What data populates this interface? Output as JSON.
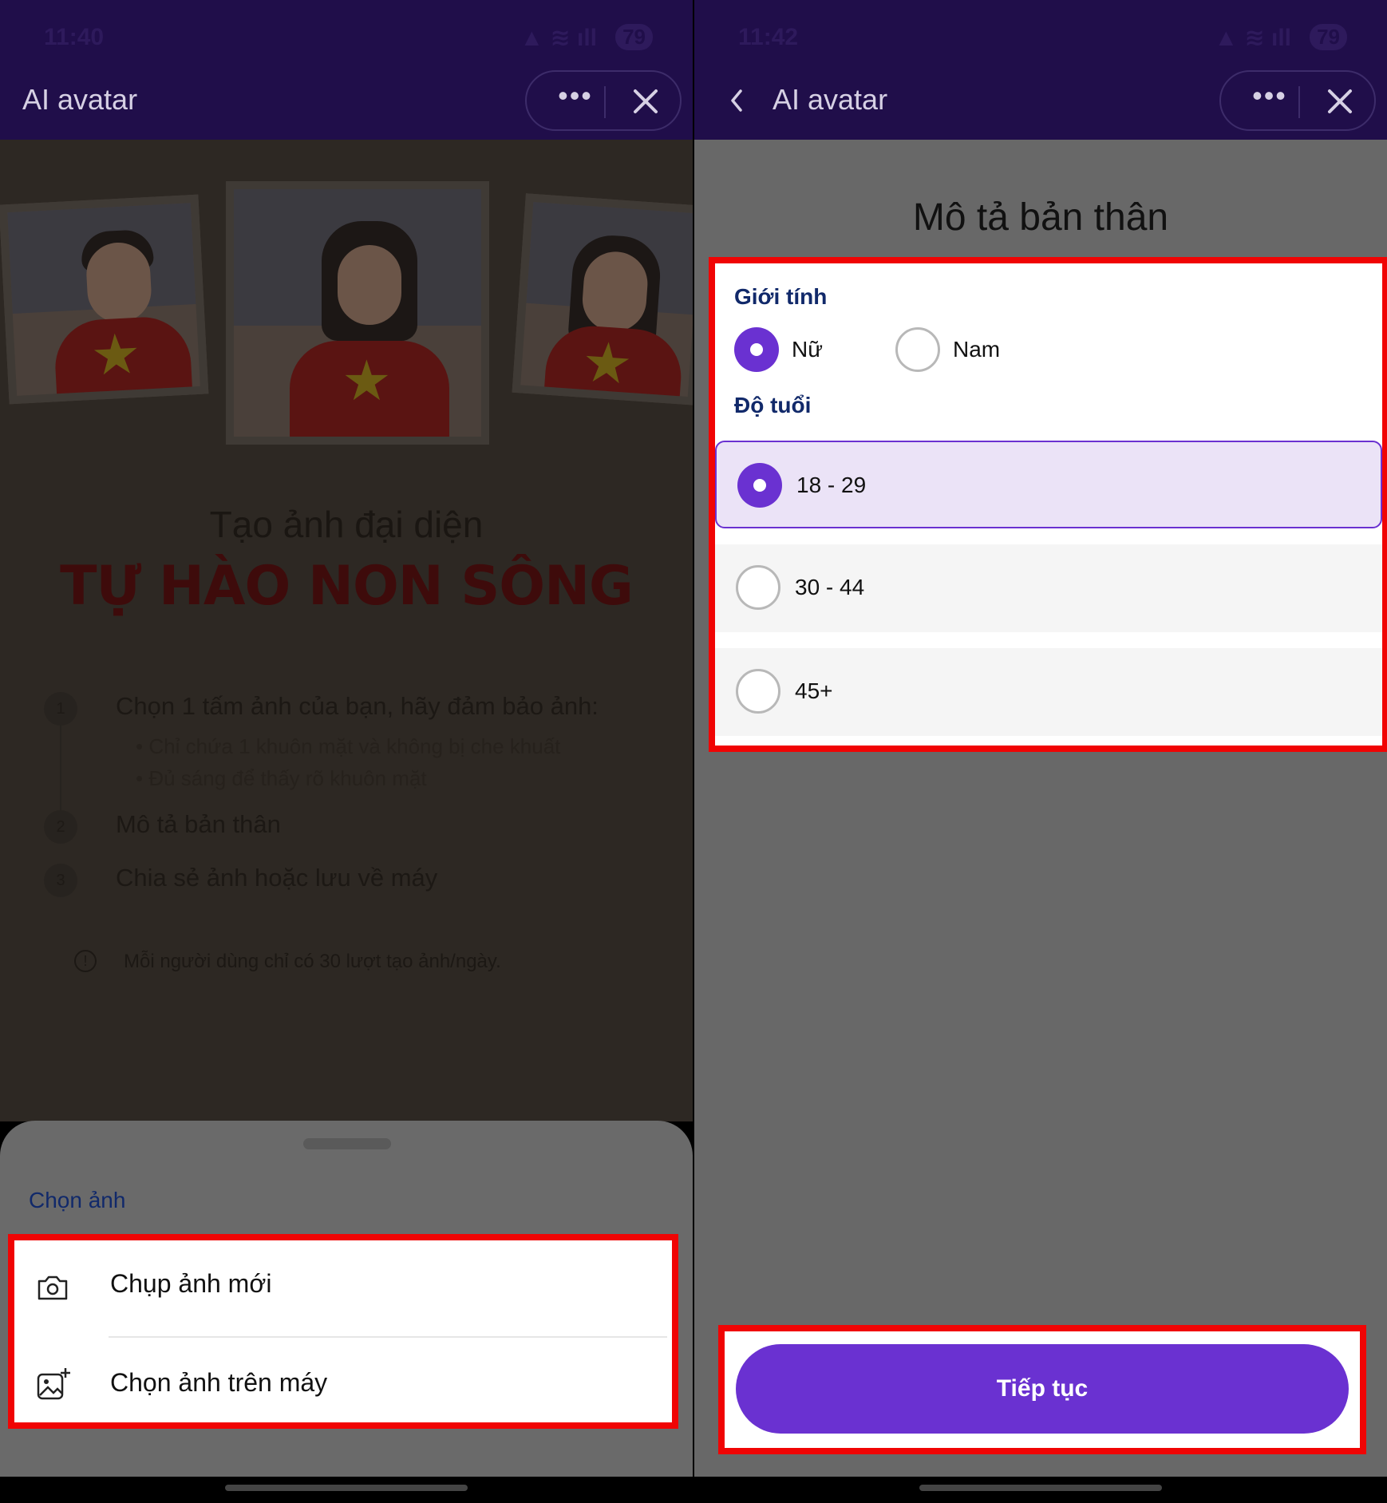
{
  "status_bar": {
    "left_time": "11:40",
    "right_time": "11:42",
    "battery": "79"
  },
  "left_screen": {
    "header_title": "AI avatar",
    "more_label": "•••",
    "banner_line1": "Tạo ảnh đại diện",
    "banner_line2": "TỰ HÀO NON SÔNG",
    "steps": [
      {
        "num": "1",
        "text": "Chọn 1 tấm ảnh của bạn, hãy đảm bảo ảnh:"
      },
      {
        "num": "2",
        "text": "Mô tả bản thân"
      },
      {
        "num": "3",
        "text": "Chia sẻ ảnh hoặc lưu về máy"
      }
    ],
    "bullets": [
      "Chỉ chứa 1 khuôn mặt và không bị che khuất",
      "Đủ sáng để thấy rõ khuôn mặt"
    ],
    "note": "Mỗi người dùng chỉ có 30 lượt tạo ảnh/ngày.",
    "note_icon": "!",
    "sheet": {
      "title": "Chọn ảnh",
      "options": [
        {
          "label": "Chụp ảnh mới",
          "icon": "camera-icon"
        },
        {
          "label": "Chọn ảnh trên máy",
          "icon": "gallery-add-icon"
        }
      ]
    }
  },
  "right_screen": {
    "header_title": "AI avatar",
    "more_label": "•••",
    "page_title": "Mô tả bản thân",
    "gender": {
      "label": "Giới tính",
      "options": [
        {
          "label": "Nữ",
          "selected": true
        },
        {
          "label": "Nam",
          "selected": false
        }
      ]
    },
    "age": {
      "label": "Độ tuổi",
      "options": [
        {
          "label": "18 - 29",
          "selected": true
        },
        {
          "label": "30 - 44",
          "selected": false
        },
        {
          "label": "45+",
          "selected": false
        }
      ]
    },
    "continue_label": "Tiếp tục"
  },
  "colors": {
    "header_bg": "#200e4a",
    "accent_purple": "#6a31d1",
    "highlight_red": "#f00404",
    "label_blue": "#11296a"
  }
}
